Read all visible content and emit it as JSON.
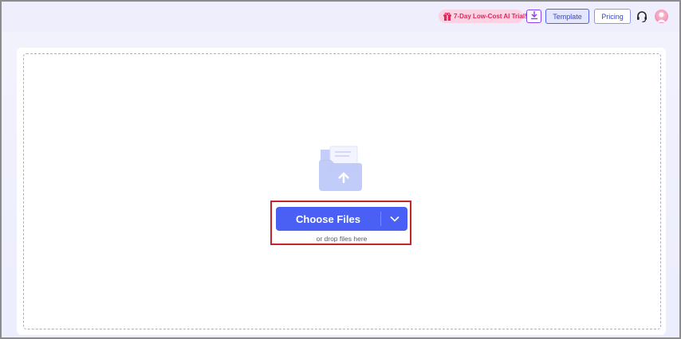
{
  "header": {
    "promo_label": "7-Day Low-Cost AI Trial!",
    "template_label": "Template",
    "pricing_label": "Pricing"
  },
  "upload": {
    "choose_label": "Choose Files",
    "drop_hint": "or drop files here"
  },
  "colors": {
    "accent": "#4a5ff3",
    "promo_text": "#e0245e",
    "promo_bg": "#fbd3e2",
    "highlight": "#c8222b"
  },
  "icons": {
    "promo": "gift-icon",
    "download": "download-icon",
    "support": "headset-icon",
    "avatar": "user-avatar-icon",
    "dropdown": "chevron-down-icon",
    "upload": "folder-upload-icon"
  }
}
